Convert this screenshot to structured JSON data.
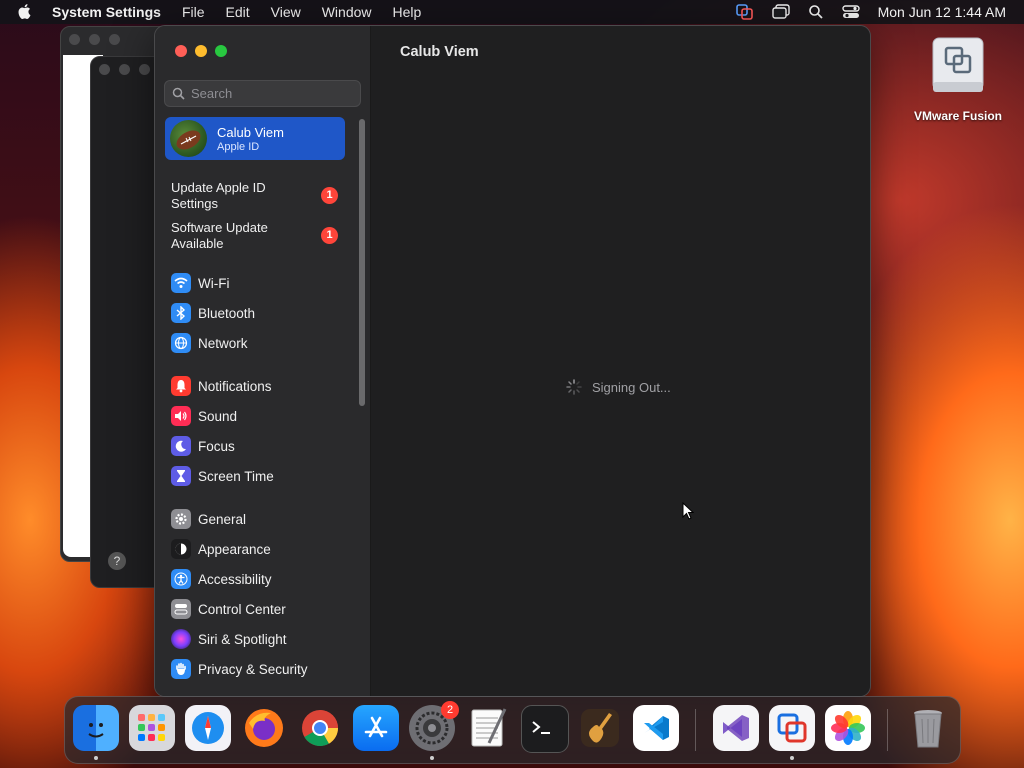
{
  "menubar": {
    "app_name": "System Settings",
    "menus": [
      "File",
      "Edit",
      "View",
      "Window",
      "Help"
    ],
    "clock": "Mon Jun 12  1:44 AM"
  },
  "window": {
    "sidebar": {
      "search_placeholder": "Search",
      "account": {
        "name": "Calub Viem",
        "subtitle": "Apple ID"
      },
      "notices": [
        {
          "label": "Update Apple ID Settings",
          "badge": "1"
        },
        {
          "label": "Software Update Available",
          "badge": "1"
        }
      ],
      "groups": [
        [
          {
            "label": "Wi-Fi",
            "icon": "wifi-icon",
            "color": "#2f8cf5"
          },
          {
            "label": "Bluetooth",
            "icon": "bluetooth-icon",
            "color": "#2f8cf5"
          },
          {
            "label": "Network",
            "icon": "globe-icon",
            "color": "#2f8cf5"
          }
        ],
        [
          {
            "label": "Notifications",
            "icon": "bell-icon",
            "color": "#ff3b30"
          },
          {
            "label": "Sound",
            "icon": "speaker-icon",
            "color": "#ff2d55"
          },
          {
            "label": "Focus",
            "icon": "moon-icon",
            "color": "#5e5ce6"
          },
          {
            "label": "Screen Time",
            "icon": "hourglass-icon",
            "color": "#5e5ce6"
          }
        ],
        [
          {
            "label": "General",
            "icon": "gear-icon",
            "color": "#8e8e93"
          },
          {
            "label": "Appearance",
            "icon": "appearance-icon",
            "color": "#1c1c1e"
          },
          {
            "label": "Accessibility",
            "icon": "accessibility-icon",
            "color": "#2f8cf5"
          },
          {
            "label": "Control Center",
            "icon": "toggles-icon",
            "color": "#8e8e93"
          },
          {
            "label": "Siri & Spotlight",
            "icon": "siri-icon",
            "color": "#8a3ffc"
          },
          {
            "label": "Privacy & Security",
            "icon": "hand-icon",
            "color": "#2f8cf5"
          }
        ]
      ]
    },
    "content": {
      "title": "Calub Viem",
      "status": "Signing Out..."
    }
  },
  "desktop": {
    "icon_label": "VMware Fusion"
  },
  "dock": {
    "apps": [
      {
        "name": "finder-icon",
        "color": "#2f9bf5",
        "running": true
      },
      {
        "name": "launchpad-icon",
        "color": "#e5e5ea",
        "running": false
      },
      {
        "name": "safari-icon",
        "color": "#1e8ef0",
        "running": false
      },
      {
        "name": "firefox-icon",
        "color": "#ff7a1a",
        "running": false
      },
      {
        "name": "chrome-icon",
        "color": "#f2f2f2",
        "running": false
      },
      {
        "name": "app-store-icon",
        "color": "#1a8cff",
        "running": false
      },
      {
        "name": "system-settings-icon",
        "color": "#8e8e93",
        "running": true,
        "badge": "2"
      },
      {
        "name": "textedit-icon",
        "color": "#f5f5f5",
        "running": false
      },
      {
        "name": "terminal-icon",
        "color": "#1c1c1e",
        "running": false
      },
      {
        "name": "garageband-icon",
        "color": "#3a2a1e",
        "running": false
      },
      {
        "name": "vscode-icon",
        "color": "#ffffff",
        "running": false
      },
      {
        "name": "visual-studio-icon",
        "color": "#f5f5f7",
        "running": false
      },
      {
        "name": "vmware-fusion-icon",
        "color": "#f5f5f7",
        "running": true
      },
      {
        "name": "photos-icon",
        "color": "#ffffff",
        "running": false
      },
      {
        "name": "trash-icon",
        "color": "#8e8e93",
        "running": false
      }
    ]
  }
}
